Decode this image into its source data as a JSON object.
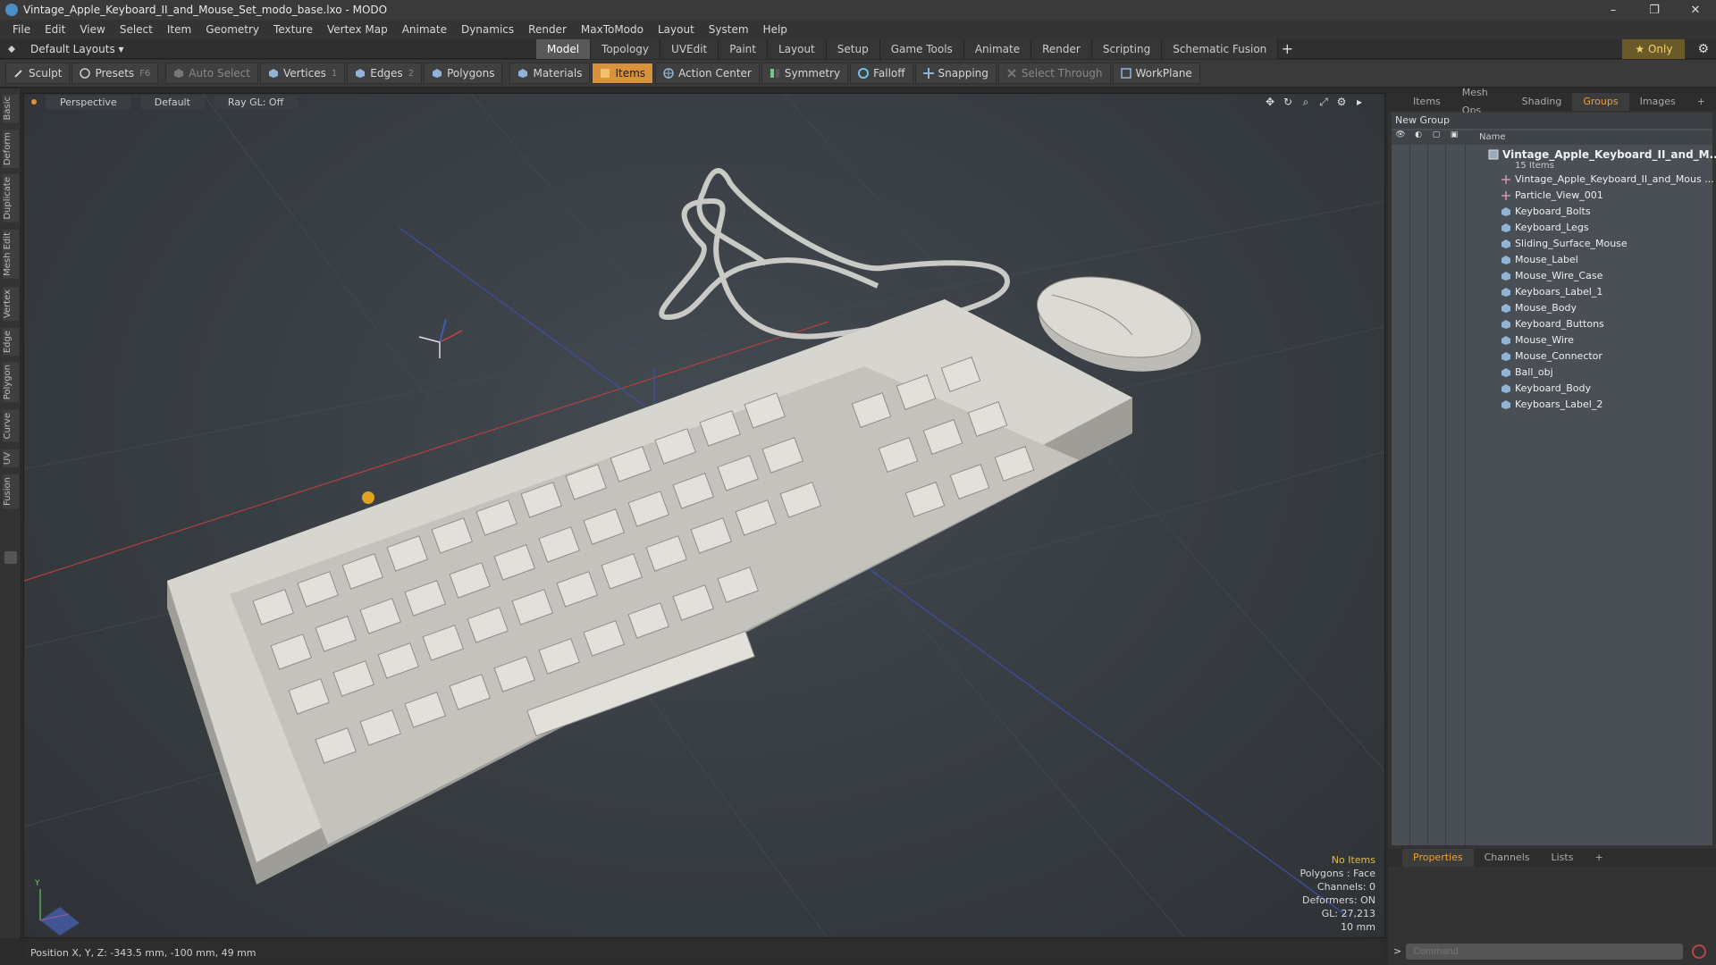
{
  "window": {
    "title": "Vintage_Apple_Keyboard_II_and_Mouse_Set_modo_base.lxo - MODO",
    "minimize": "–",
    "restore": "❐",
    "close": "✕"
  },
  "menu": [
    "File",
    "Edit",
    "View",
    "Select",
    "Item",
    "Geometry",
    "Texture",
    "Vertex Map",
    "Animate",
    "Dynamics",
    "Render",
    "MaxToModo",
    "Layout",
    "System",
    "Help"
  ],
  "layouts": {
    "label": "Default Layouts ▾",
    "tabs": [
      "Model",
      "Topology",
      "UVEdit",
      "Paint",
      "Layout",
      "Setup",
      "Game Tools",
      "Animate",
      "Render",
      "Scripting",
      "Schematic Fusion"
    ],
    "active_tab": "Model",
    "plus": "+",
    "only": "★ Only",
    "gear": "⚙"
  },
  "toolbar": {
    "sculpt": "Sculpt",
    "presets": "Presets",
    "presets_key": "F6",
    "auto_select": "Auto Select",
    "vertices": "Vertices",
    "vertices_count": "1",
    "edges": "Edges",
    "edges_count": "2",
    "polygons": "Polygons",
    "materials": "Materials",
    "items": "Items",
    "action_center": "Action Center",
    "symmetry": "Symmetry",
    "falloff": "Falloff",
    "snapping": "Snapping",
    "select_through": "Select Through",
    "workplane": "WorkPlane"
  },
  "left_tabs": [
    "Basic",
    "Deform",
    "Duplicate",
    "Mesh Edit",
    "Vertex",
    "Edge",
    "Polygon",
    "Curve",
    "UV",
    "Fusion"
  ],
  "viewport": {
    "view": "Perspective",
    "shading": "Default",
    "raygl": "Ray GL: Off",
    "info": {
      "no_items": "No Items",
      "polygons": "Polygons : Face",
      "channels": "Channels: 0",
      "deformers": "Deformers: ON",
      "gl": "GL: 27,213",
      "scale": "10 mm"
    },
    "axis_y": "Y",
    "axis_x": "X",
    "axis_z": "Z"
  },
  "status": {
    "position": "Position X, Y, Z:  -343.5 mm, -100 mm, 49 mm"
  },
  "panel": {
    "tabs": [
      "Items",
      "Mesh Ops",
      "Shading",
      "Groups",
      "Images"
    ],
    "active_tab": "Groups",
    "plus": "+",
    "new_group": "New Group",
    "name_header": "Name",
    "root_name": "Vintage_Apple_Keyboard_II_and_M...",
    "root_count": "15 Items",
    "items": [
      "Vintage_Apple_Keyboard_II_and_Mous ...",
      "Particle_View_001",
      "Keyboard_Bolts",
      "Keyboard_Legs",
      "Sliding_Surface_Mouse",
      "Mouse_Label",
      "Mouse_Wire_Case",
      "Keyboars_Label_1",
      "Mouse_Body",
      "Keyboard_Buttons",
      "Mouse_Wire",
      "Mouse_Connector",
      "Ball_obj",
      "Keyboard_Body",
      "Keyboars_Label_2"
    ],
    "props_tabs": [
      "Properties",
      "Channels",
      "Lists"
    ],
    "props_active": "Properties",
    "command_placeholder": "Command",
    "command_arrow": ">"
  },
  "colors": {
    "accent": "#d9913a",
    "viewport_bg": "#3b4046",
    "groups_bg": "#4a4f55"
  }
}
